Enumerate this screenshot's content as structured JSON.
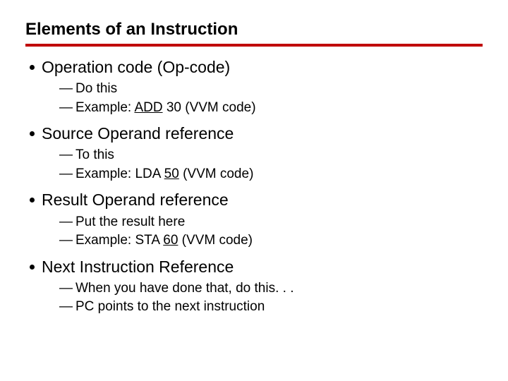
{
  "title": "Elements of an Instruction",
  "items": [
    {
      "label": "Operation code (Op-code)",
      "subs": [
        {
          "text": "Do this"
        },
        {
          "prefix": "Example: ",
          "u": "ADD",
          "rest": " 30  (VVM code)"
        }
      ]
    },
    {
      "label": "Source Operand reference",
      "subs": [
        {
          "text": "To this"
        },
        {
          "prefix": "Example: LDA ",
          "u": "50",
          "rest": "  (VVM code)"
        }
      ]
    },
    {
      "label": "Result Operand reference",
      "subs": [
        {
          "text": "Put the result here"
        },
        {
          "prefix": "Example: STA ",
          "u": "60",
          "rest": "  (VVM code)"
        }
      ]
    },
    {
      "label": "Next Instruction Reference",
      "subs": [
        {
          "text": "When you have done that, do this. . ."
        },
        {
          "text": "PC points to the next instruction"
        }
      ]
    }
  ],
  "dash": "—"
}
